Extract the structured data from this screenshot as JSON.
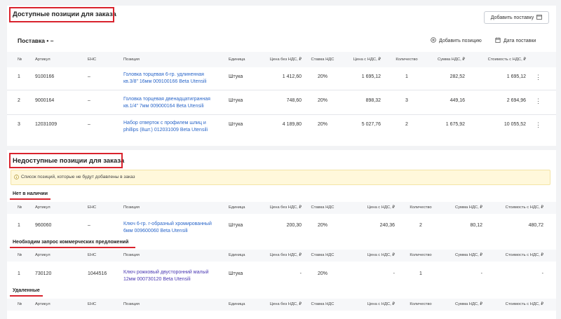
{
  "available": {
    "title": "Доступные позиции для заказа",
    "add_delivery_button": "Добавить поставку",
    "delivery_title": "Поставка • –",
    "add_position_button": "Добавить позицию",
    "delivery_date_button": "Дата поставки",
    "columns": [
      "№",
      "Артикул",
      "ЕНС",
      "Позиция",
      "Единица",
      "Цена без НДС, ₽",
      "Ставка НДС",
      "Цена с НДС, ₽",
      "Количество",
      "Сумма НДС, ₽",
      "Стоимость с НДС, ₽"
    ],
    "rows": [
      {
        "num": "1",
        "article": "9100166",
        "ens": "–",
        "position": "Головка торцевая 6-гр. удлиненная кв.3/8\" 16мм 009100166 Beta Utensili",
        "unit": "Штука",
        "price_no_vat": "1 412,60",
        "vat_rate": "20%",
        "price_vat": "1 695,12",
        "qty": "1",
        "vat_sum": "282,52",
        "total": "1 695,12"
      },
      {
        "num": "2",
        "article": "9000164",
        "ens": "–",
        "position": "Головка торцевая двенадцатигранная кв.1/4\" 7мм 009000164 Beta Utensili",
        "unit": "Штука",
        "price_no_vat": "748,60",
        "vat_rate": "20%",
        "price_vat": "898,32",
        "qty": "3",
        "vat_sum": "449,16",
        "total": "2 694,96"
      },
      {
        "num": "3",
        "article": "12031009",
        "ens": "–",
        "position": "Набор отверток с профилем шлиц и phillips (8шт.) 012031009 Beta Utensili",
        "unit": "Штука",
        "price_no_vat": "4 189,80",
        "vat_rate": "20%",
        "price_vat": "5 027,76",
        "qty": "2",
        "vat_sum": "1 675,92",
        "total": "10 055,52"
      }
    ]
  },
  "unavailable": {
    "title": "Недоступные позиции для заказа",
    "warning": "Список позиций, которые не будут добавлены в заказ",
    "columns": [
      "№",
      "Артикул",
      "ЕНС",
      "Позиция",
      "Единица",
      "Цена без НДС, ₽",
      "Ставка НДС",
      "Цена с НДС, ₽",
      "Количество",
      "Сумма НДС, ₽",
      "Стоимость с НДС, ₽"
    ],
    "out_of_stock": {
      "title": "Нет в наличии",
      "rows": [
        {
          "num": "1",
          "article": "960060",
          "ens": "–",
          "position": "Ключ 6-гр. г-образный хромированный 6мм 009600060 Beta Utensili",
          "unit": "Штука",
          "price_no_vat": "200,30",
          "vat_rate": "20%",
          "price_vat": "240,36",
          "qty": "2",
          "vat_sum": "80,12",
          "total": "480,72"
        }
      ]
    },
    "quote_needed": {
      "title": "Необходим запрос коммерческих предложений",
      "rows": [
        {
          "num": "1",
          "article": "730120",
          "ens": "1044516",
          "position": "Ключ рожковый двусторонний малый 12мм 000730120 Beta Utensili",
          "unit": "Штука",
          "price_no_vat": "-",
          "vat_rate": "20%",
          "price_vat": "-",
          "qty": "1",
          "vat_sum": "-",
          "total": "-"
        }
      ]
    },
    "deleted": {
      "title": "Удаленные"
    }
  },
  "icons": {
    "add_delivery": "calendar-truck-icon",
    "add_position": "plus-circle-icon",
    "delivery_date": "calendar-icon",
    "row_menu": "kebab-menu-icon",
    "warning": "info-icon"
  },
  "colors": {
    "link": "#2a66c9",
    "link_visited": "#4b39b3",
    "annotation_red": "#d9232d",
    "warning_bg": "#fff8db"
  }
}
